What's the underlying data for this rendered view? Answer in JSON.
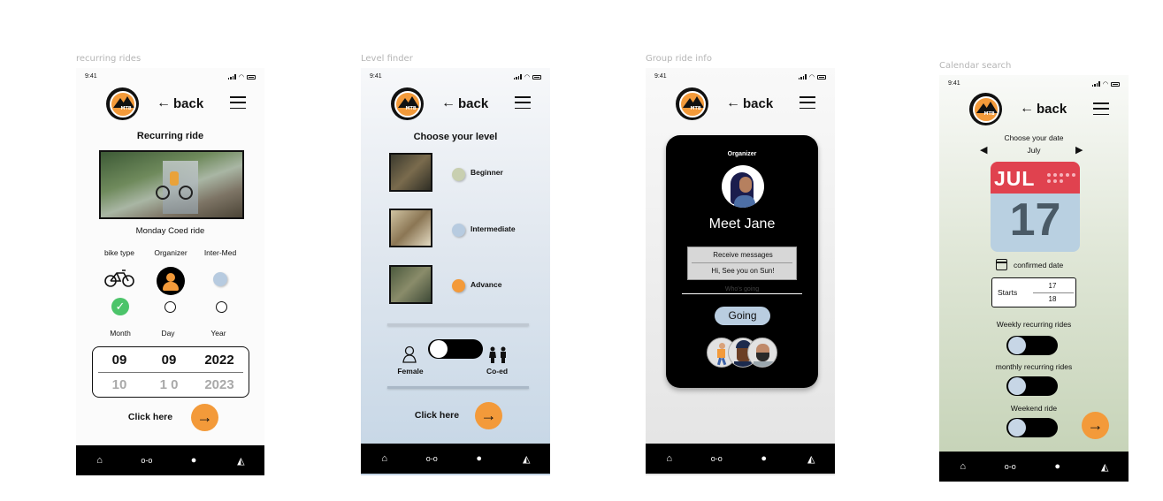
{
  "frames": [
    {
      "label": "recurring rides"
    },
    {
      "label": "Level finder"
    },
    {
      "label": "Group ride info"
    },
    {
      "label": "Calendar search"
    }
  ],
  "common": {
    "time": "9:41",
    "logo_text": "MTB",
    "back_label": "back",
    "back_arrow": "←"
  },
  "recurring": {
    "title": "Recurring ride",
    "ride_name": "Monday Coed ride",
    "col_bike": "bike type",
    "col_organizer": "Organizer",
    "col_level": "Inter-Med",
    "month_label": "Month",
    "day_label": "Day",
    "year_label": "Year",
    "month_sel": "09",
    "day_sel": "09",
    "year_sel": "2022",
    "month_next": "10",
    "day_next": "1 0",
    "year_next": "2023",
    "cta": "Click here"
  },
  "level": {
    "title": "Choose your level",
    "levels": [
      "Beginner",
      "Intermediate",
      "Advance"
    ],
    "female": "Female",
    "coed": "Co-ed",
    "cta": "Click here"
  },
  "group": {
    "organizer_label": "Organizer",
    "name": "Meet Jane",
    "msg_title": "Receive messages",
    "msg_body": "Hi, See you on Sun!",
    "whos_going": "Who's going",
    "going_btn": "Going"
  },
  "calendar": {
    "choose": "Choose  your date",
    "month": "July",
    "cal_month": "JUL",
    "cal_day": "17",
    "confirmed": "confirmed date",
    "starts": "Starts",
    "start_a": "17",
    "start_b": "18",
    "weekly": "Weekly  recurring rides",
    "monthly": "monthly recurring rides",
    "weekend": "Weekend  ride"
  },
  "colors": {
    "accent": "#f39a3a",
    "check": "#4cc46a",
    "level_beginner": "#c8cfb0",
    "level_intermediate": "#b7cbe0",
    "level_advance": "#f39a3a",
    "calendar_red": "#e0424f",
    "calendar_blue": "#b9d0e1"
  }
}
